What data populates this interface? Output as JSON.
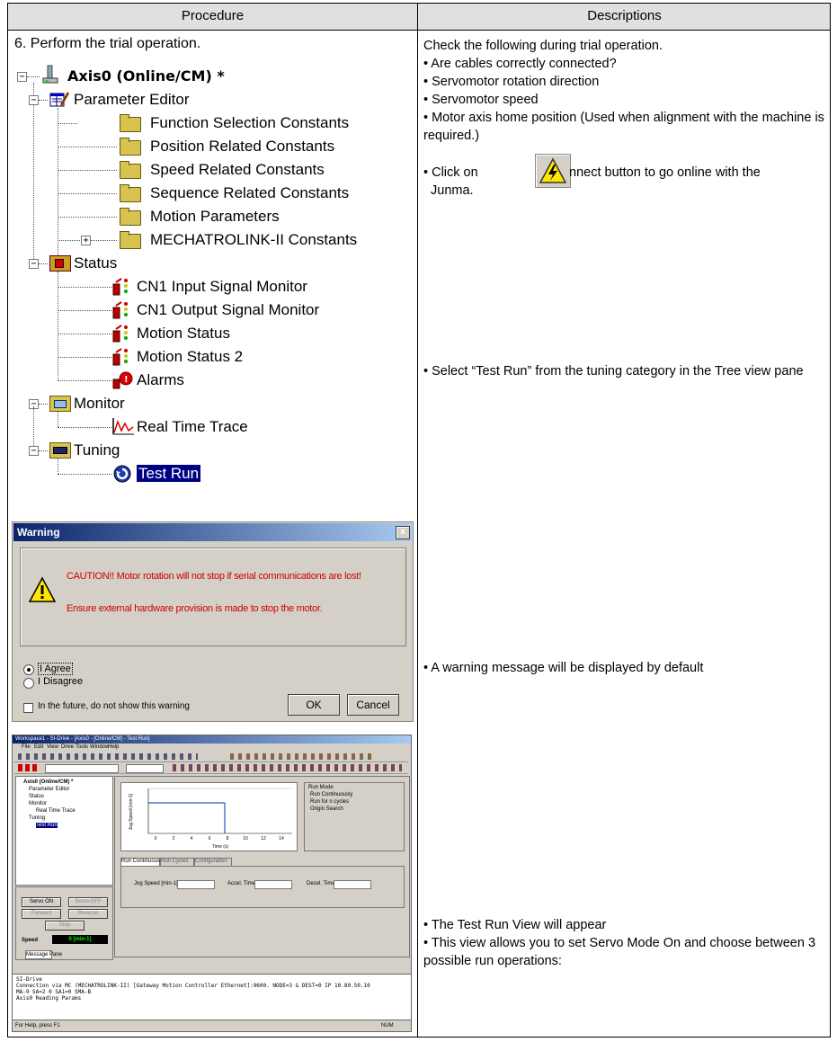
{
  "header": {
    "procedure": "Procedure",
    "descriptions": "Descriptions"
  },
  "step": "6. Perform the trial operation.",
  "tree": {
    "axis": "Axis0 (Online/CM) *",
    "parameter_editor": "Parameter Editor",
    "param_items": [
      "Function Selection Constants",
      "Position Related Constants",
      "Speed Related Constants",
      "Sequence Related Constants",
      "Motion Parameters",
      "MECHATROLINK-II Constants"
    ],
    "status": "Status",
    "status_items": [
      "CN1 Input Signal Monitor",
      "CN1 Output Signal Monitor",
      "Motion Status",
      "Motion Status 2",
      "Alarms"
    ],
    "monitor": "Monitor",
    "monitor_items": [
      "Real Time Trace"
    ],
    "tuning": "Tuning",
    "tuning_items": [
      "Test Run"
    ]
  },
  "descriptions": {
    "intro": "Check the following during trial operation.",
    "checks": [
      "• Are cables correctly connected?",
      "• Servomotor rotation direction",
      "• Servomotor speed",
      "• Motor axis home position (Used when alignment with the machine is required.)"
    ],
    "connect_a": "• Click on",
    "connect_b": "nnect button to go online with the",
    "connect_c": "Junma.",
    "test_run": "• Select “Test Run” from the tuning category in the Tree view pane",
    "warning": "• A warning message will be displayed by default",
    "view_1": "• The Test Run View will appear",
    "view_2": "• This view allows you to set Servo Mode On and choose between 3 possible run operations:"
  },
  "warning_dialog": {
    "title": "Warning",
    "close": "x",
    "line1": "CAUTION!! Motor rotation will not stop if serial communications are lost!",
    "line2": "Ensure external hardware provision is made to stop the motor.",
    "agree": "I Agree",
    "disagree": "I Disagree",
    "future": "In the future, do not show this warning",
    "ok": "OK",
    "cancel": "Cancel"
  },
  "test_run_window": {
    "title": "Workspace1 - SI-Drive - [Axis0 - [Online/CM] - Test Run]",
    "menu": [
      "File",
      "Edit",
      "View",
      "Drive",
      "Tools",
      "Window",
      "Help"
    ],
    "tree": [
      "Axis0 (Online/CM) *",
      "Parameter Editor",
      "Status",
      "Monitor",
      "Real Time Trace",
      "Tuning",
      "Test Run"
    ],
    "servo_on": "Servo ON",
    "servo_off": "Servo OFF",
    "forward": "Forward",
    "reverse": "Reverse",
    "stop": "Stop",
    "speed_label": "Speed",
    "speed_value": "0 [min-1]",
    "run_mode_title": "Run Mode",
    "run_modes": [
      "Run Continuously",
      "Run for n cycles",
      "Origin Search"
    ],
    "tabs": [
      "Run Continuous",
      "Run Cycles",
      "Configuration"
    ],
    "fields": [
      "Jog Speed [min-1]",
      "Accel. Time",
      "Decel. Time"
    ],
    "x_ticks": [
      "0",
      "2",
      "4",
      "6",
      "8",
      "10",
      "12",
      "14"
    ],
    "x_label": "Time (s)",
    "y_label": "Jog Speed [min-1]",
    "log_lines": [
      "SI-Drive",
      "Connection via MC (MECHATROLINK-II) [Gateway Motion Controller Ethernet]:9600. NODE=3 & DEST=0 IP 10.80.50.10",
      "MA-9 SA=2 0 SA1=0 SMA-B",
      "Axis0 Reading Params"
    ],
    "log_tab": "Message Pane",
    "status_left": "For Help, press F1",
    "status_right": "NUM"
  }
}
